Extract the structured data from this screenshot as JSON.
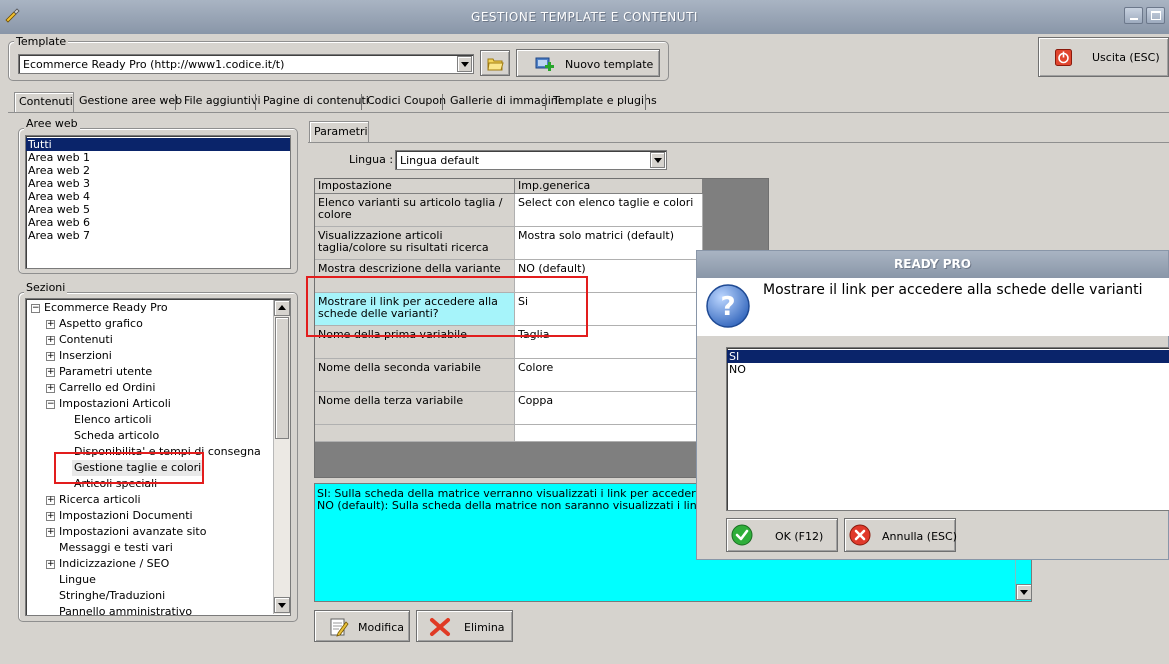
{
  "window": {
    "title": "GESTIONE TEMPLATE E CONTENUTI"
  },
  "template_group": {
    "label": "Template",
    "selected": "Ecommerce Ready Pro (http://www1.codice.it/t)",
    "new_button": "Nuovo template"
  },
  "exit_button": "Uscita (ESC)",
  "tabs": [
    {
      "label": "Contenuti",
      "active": true
    },
    {
      "label": "Gestione aree web"
    },
    {
      "label": "File aggiuntivi"
    },
    {
      "label": "Pagine di contenuti"
    },
    {
      "label": "Codici Coupon"
    },
    {
      "label": "Gallerie di immagini"
    },
    {
      "label": "Template e plugins"
    }
  ],
  "aree_web": {
    "label": "Aree web",
    "items": [
      "Tutti",
      "Area web 1",
      "Area web 2",
      "Area web 3",
      "Area web 4",
      "Area web 5",
      "Area web 6",
      "Area web 7"
    ]
  },
  "sezioni": {
    "label": "Sezioni",
    "tree": [
      {
        "label": "Ecommerce Ready Pro",
        "expander": "−"
      },
      {
        "label": "Aspetto grafico",
        "expander": "+"
      },
      {
        "label": "Contenuti",
        "expander": "+"
      },
      {
        "label": "Inserzioni",
        "expander": "+"
      },
      {
        "label": "Parametri utente",
        "expander": "+"
      },
      {
        "label": "Carrello ed Ordini",
        "expander": "+"
      },
      {
        "label": "Impostazioni Articoli",
        "expander": "−"
      },
      {
        "label": "Elenco articoli"
      },
      {
        "label": "Scheda articolo"
      },
      {
        "label": "Disponibilita' e tempi di consegna"
      },
      {
        "label": "Gestione taglie e colori",
        "selected": true
      },
      {
        "label": "Articoli speciali"
      },
      {
        "label": "Ricerca articoli",
        "expander": "+"
      },
      {
        "label": "Impostazioni Documenti",
        "expander": "+"
      },
      {
        "label": "Impostazioni avanzate sito",
        "expander": "+"
      },
      {
        "label": "Messaggi e testi vari"
      },
      {
        "label": "Indicizzazione / SEO",
        "expander": "+"
      },
      {
        "label": "Lingue"
      },
      {
        "label": "Stringhe/Traduzioni"
      },
      {
        "label": "Pannello amministrativo"
      }
    ]
  },
  "parametri": {
    "tab_label": "Parametri",
    "lingua_label": "Lingua :",
    "lingua_value": "Lingua default",
    "columns": [
      "Impostazione",
      "Imp.generica"
    ],
    "rows": [
      {
        "setting": "Elenco varianti su articolo taglia / colore",
        "value": "Select con elenco taglie e colori"
      },
      {
        "setting": "Visualizzazione articoli taglia/colore su risultati ricerca",
        "value": "Mostra solo matrici (default)"
      },
      {
        "setting": "Mostra descrizione della variante",
        "value": "NO (default)"
      },
      {
        "setting": "Mostrare il link per accedere alla schede delle varianti?",
        "value": "Si",
        "highlighted": true
      },
      {
        "setting": "Nome della prima variabile",
        "value": "Taglia"
      },
      {
        "setting": "Nome della seconda variabile",
        "value": "Colore"
      },
      {
        "setting": "Nome della terza variabile",
        "value": "Coppa"
      }
    ],
    "description_lines": [
      "SI: Sulla scheda della matrice verranno visualizzati i link per accedere alla schede",
      "NO (default): Sulla scheda della matrice non saranno visualizzati i link per le sche"
    ],
    "modify_button": "Modifica",
    "delete_button": "Elimina"
  },
  "dialog": {
    "title": "READY PRO",
    "question": "Mostrare il link per accedere alla schede delle varianti",
    "options": [
      "SI",
      "NO"
    ],
    "selected_option": "SI",
    "ok_button": "OK (F12)",
    "cancel_button": "Annulla (ESC)"
  },
  "colors": {
    "title_bar": "#8996a8",
    "selection": "#0a246a",
    "description_bg": "#00ffff",
    "highlight_box": "#e21d1d"
  }
}
